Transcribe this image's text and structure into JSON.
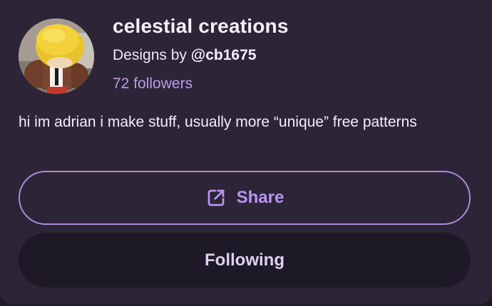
{
  "profile": {
    "name": "celestial creations",
    "designs_prefix": "Designs by",
    "handle": "@cb1675",
    "followers_count": "72",
    "followers_label": "followers",
    "bio": "hi im adrian i make stuff, usually more “unique” free patterns"
  },
  "actions": {
    "share_label": "Share",
    "following_label": "Following"
  },
  "icons": {
    "share": "external-link-icon"
  },
  "colors": {
    "card_background": "#2c2538",
    "accent": "#b994f0",
    "following_button": "#1e1927"
  }
}
